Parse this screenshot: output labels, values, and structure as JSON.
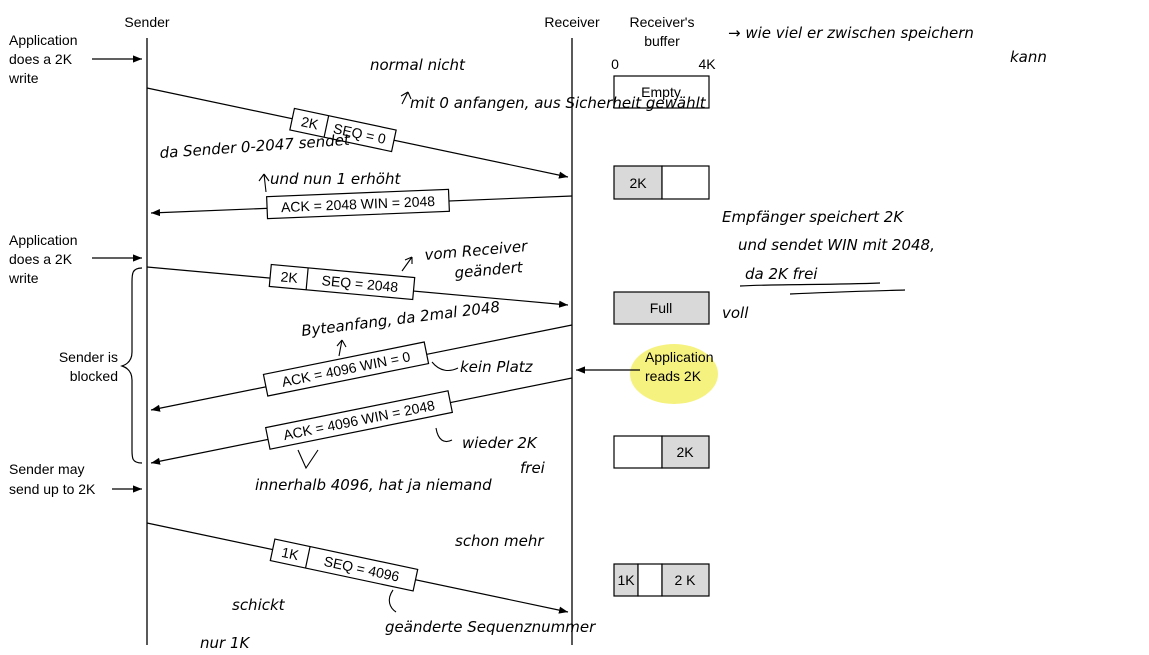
{
  "columns": {
    "sender": "Sender",
    "receiver": "Receiver",
    "buffer_title_line1": "Receiver's",
    "buffer_title_line2": "buffer",
    "buffer_scale_min": "0",
    "buffer_scale_max": "4K"
  },
  "left_labels": {
    "write1": [
      "Application",
      "does a 2K",
      "write"
    ],
    "write2": [
      "Application",
      "does a 2K",
      "write"
    ],
    "blocked": [
      "Sender is",
      "blocked"
    ],
    "may_send": [
      "Sender may",
      "send up to 2K"
    ]
  },
  "right_labels": {
    "app_reads": [
      "Application",
      "reads 2K"
    ]
  },
  "packets": {
    "p1_size": "2K",
    "p1_seq": "SEQ = 0",
    "ack1": "ACK = 2048 WIN = 2048",
    "p2_size": "2K",
    "p2_seq": "SEQ = 2048",
    "ack2": "ACK = 4096 WIN = 0",
    "ack3": "ACK = 4096 WIN = 2048",
    "p3_size": "1K",
    "p3_seq": "SEQ = 4096"
  },
  "buffers": {
    "b1": "Empty",
    "b2": "2K",
    "b3": "Full",
    "b4": "2K",
    "b5_left": "1K",
    "b5_right": "2 K"
  },
  "handwritten": {
    "top_right": [
      "→ wie viel er zwischen speichern",
      "kann"
    ],
    "seq0_note": [
      "normal nicht",
      "mit 0 anfangen, aus Sicherheit gewählt"
    ],
    "sender_note": [
      "da Sender 0-2047 sendet",
      "und nun 1 erhöht"
    ],
    "receiver_note": [
      "Empfänger speichert 2K",
      "und sendet WIN mit 2048,",
      "da 2K frei"
    ],
    "voll": "voll",
    "seq2048_note": [
      "vom Receiver",
      "geändert"
    ],
    "byte_note": "Byteanfang, da 2mal 2048",
    "kein_platz": "kein Platz",
    "wieder_frei": [
      "wieder 2K",
      "frei"
    ],
    "innerhalb": [
      "innerhalb 4096, hat ja niemand",
      "schon mehr"
    ],
    "schickt": [
      "schickt",
      "nur 1K"
    ],
    "geaendert_seq": "geänderte Sequenznummer"
  },
  "colors": {
    "buffer_fill": "#d9d9d9",
    "highlight": "#f4f06a",
    "ink": "#000000"
  }
}
